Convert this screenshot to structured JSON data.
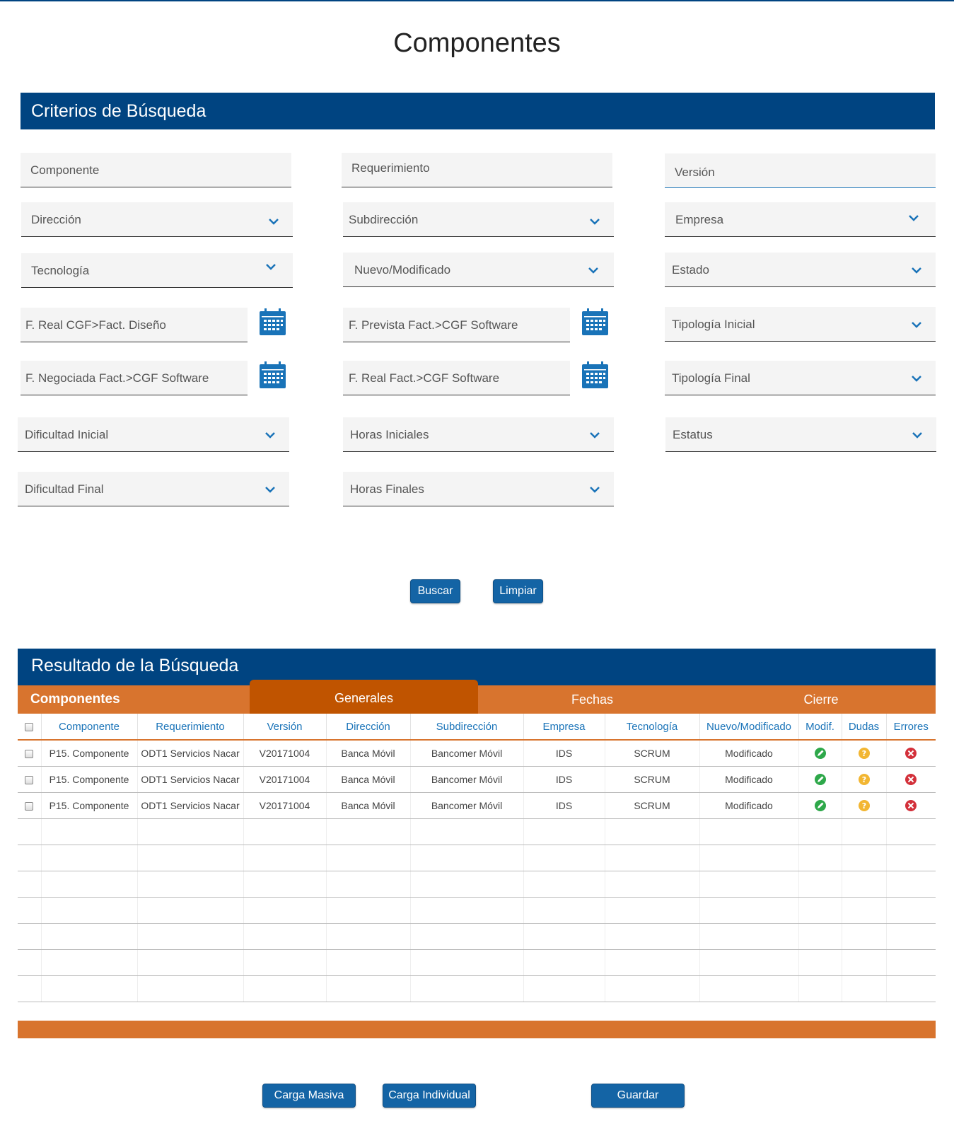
{
  "page_title": "Componentes",
  "criteria": {
    "title": "Criterios de Búsqueda",
    "fields": {
      "componente": "Componente",
      "requerimiento": "Requerimiento",
      "version": "Versión",
      "direccion": "Dirección",
      "subdireccion": "Subdirección",
      "empresa": "Empresa",
      "tecnologia": "Tecnología",
      "nuevo_modificado": "Nuevo/Modificado",
      "estado": "Estado",
      "f_real_cgf_diseno": "F. Real CGF>Fact. Diseño",
      "f_prevista_cgf_software": "F. Prevista Fact.>CGF Software",
      "tipologia_inicial": "Tipología Inicial",
      "f_negociada_cgf_software": "F. Negociada Fact.>CGF Software",
      "f_real_cgf_software": "F. Real Fact.>CGF Software",
      "tipologia_final": "Tipología Final",
      "dificultad_inicial": "Dificultad Inicial",
      "horas_iniciales": "Horas Iniciales",
      "estatus": "Estatus",
      "dificultad_final": "Dificultad Final",
      "horas_finales": "Horas Finales"
    },
    "buttons": {
      "buscar": "Buscar",
      "limpiar": "Limpiar"
    }
  },
  "results": {
    "title": "Resultado de la Búsqueda",
    "tabs": {
      "componentes": "Componentes",
      "generales": "Generales",
      "fechas": "Fechas",
      "cierre": "Cierre"
    },
    "columns": {
      "componente": "Componente",
      "requerimiento": "Requerimiento",
      "version": "Versión",
      "direccion": "Dirección",
      "subdireccion": "Subdirección",
      "empresa": "Empresa",
      "tecnologia": "Tecnología",
      "nuevo_modificado": "Nuevo/Modificado",
      "modif": "Modif.",
      "dudas": "Dudas",
      "errores": "Errores"
    },
    "rows": [
      {
        "componente": "P15. Componente",
        "requerimiento": "ODT1 Servicios Nacar",
        "version": "V20171004",
        "direccion": "Banca Móvil",
        "subdireccion": "Bancomer Móvil",
        "empresa": "IDS",
        "tecnologia": "SCRUM",
        "nuevo_modificado": "Modificado"
      },
      {
        "componente": "P15. Componente",
        "requerimiento": "ODT1 Servicios Nacar",
        "version": "V20171004",
        "direccion": "Banca Móvil",
        "subdireccion": "Bancomer Móvil",
        "empresa": "IDS",
        "tecnologia": "SCRUM",
        "nuevo_modificado": "Modificado"
      },
      {
        "componente": "P15. Componente",
        "requerimiento": "ODT1 Servicios Nacar",
        "version": "V20171004",
        "direccion": "Banca Móvil",
        "subdireccion": "Bancomer Móvil",
        "empresa": "IDS",
        "tecnologia": "SCRUM",
        "nuevo_modificado": "Modificado"
      }
    ],
    "icons": {
      "modif": "edit-check-icon",
      "dudas": "question-icon",
      "errores": "error-x-icon"
    }
  },
  "footer_buttons": {
    "carga_masiva": "Carga Masiva",
    "carga_individual": "Carga Individual",
    "guardar": "Guardar"
  },
  "colors": {
    "navy": "#004481",
    "orange": "#d8742e",
    "orange_active": "#c05400",
    "button_blue": "#1464a5",
    "link_blue": "#1973b8",
    "green": "#2ea84a",
    "yellow": "#f2b632",
    "red": "#d3303a"
  }
}
